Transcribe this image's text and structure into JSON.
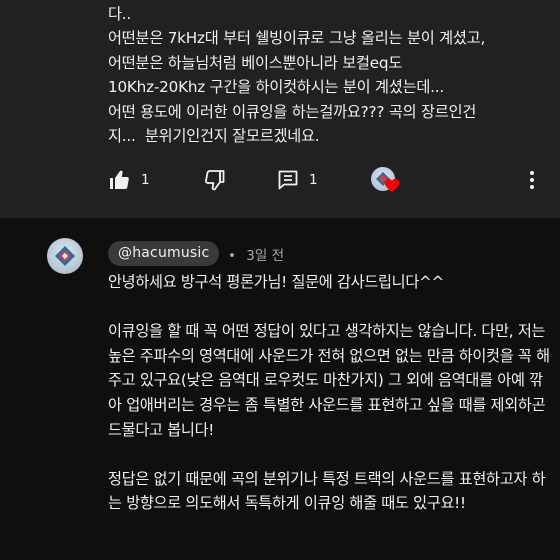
{
  "parent_comment": {
    "lines": [
      "다..",
      "어떤분은 7kHz대 부터 쉘빙이큐로 그냥 올리는 분이 계셨고,",
      "어떤분은 하늘님처럼 베이스뿐아니라 보컬eq도",
      "10Khz-20Khz 구간을 하이컷하시는 분이 계셨는데...",
      "어떤 용도에 이러한 이큐잉을 하는걸까요??? 곡의 장르인건",
      "지...  분위기인건지 잘모르겠네요."
    ],
    "like_count": "1",
    "reply_count": "1",
    "icons": {
      "like": "thumbs-up-filled-icon",
      "dislike": "thumbs-down-icon",
      "reply": "comment-icon",
      "creator_heart": "creator-heart-icon",
      "more": "more-vert-icon"
    }
  },
  "reply": {
    "author": "@hacumusic",
    "separator": "•",
    "time": "3일 전",
    "paragraphs": [
      "안녕하세요 방구석 평론가님! 질문에 감사드립니다^^",
      "이큐잉을 할 때 꼭 어떤 정답이 있다고 생각하지는 않습니다. 다만, 저는 높은 주파수의 영역대에 사운드가 전혀 없으면 없는 만큼 하이컷을 꼭 해주고 있구요(낮은 음역대 로우컷도 마찬가지) 그 외에 음역대를 아예 깎아 업애버리는 경우는 좀 특별한 사운드를 표현하고 싶을 때를 제외하곤 드물다고 봅니다!",
      "정답은 없기 때문에 곡의 분위기나 특정 트랙의 사운드를 표현하고자 하는 방향으로 의도해서 독특하게 이큐잉 해줄 때도 있구요!!"
    ]
  },
  "colors": {
    "background": "#0f0f0f",
    "highlighted_comment_bg": "#212121",
    "text": "#f1f1f1",
    "secondary_text": "#aaaaaa",
    "chip_bg": "#3a3a3a",
    "heart": "#ff0000"
  }
}
